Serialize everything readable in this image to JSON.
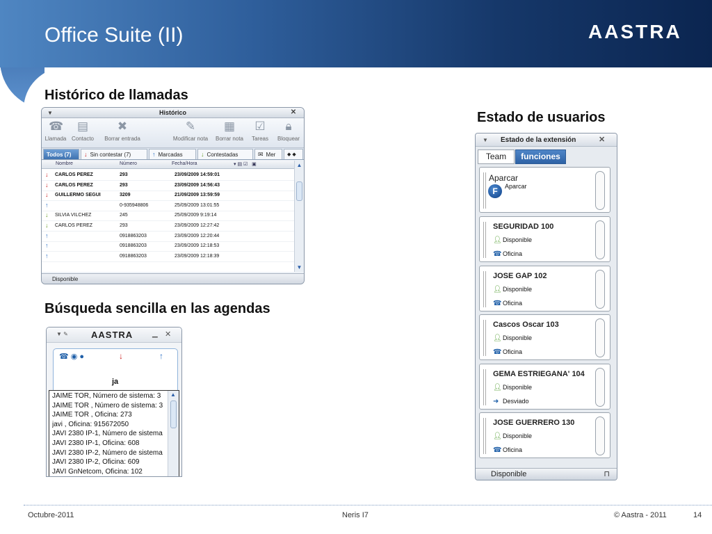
{
  "slide": {
    "title": "Office Suite (II)",
    "logo": "AASTRA",
    "footer": {
      "date": "Octubre-2011",
      "center": "Neris I7",
      "copyright": "© Aastra - 2011",
      "page": "14"
    }
  },
  "sections": {
    "history_heading": "Histórico de llamadas",
    "status_heading": "Estado de usuarios",
    "search_heading": "Búsqueda sencilla en las agendas"
  },
  "history_window": {
    "title": "Histórico",
    "toolbar": [
      {
        "label": "Llamada",
        "icon": "call-icon"
      },
      {
        "label": "Contacto",
        "icon": "contact-card-icon"
      },
      {
        "label": "Borrar entrada",
        "icon": "delete-x-icon"
      },
      {
        "label": "Modificar nota",
        "icon": "edit-note-icon"
      },
      {
        "label": "Borrar nota",
        "icon": "delete-note-icon"
      },
      {
        "label": "Tareas",
        "icon": "tasks-icon"
      },
      {
        "label": "Bloquear",
        "icon": "lock-icon"
      }
    ],
    "tabs": [
      "Todos (7)",
      "Sin contestar (7)",
      "Marcadas",
      "Contestadas",
      "Mer"
    ],
    "columns": [
      "Nombre",
      "Número",
      "Fecha/Hora"
    ],
    "rows": [
      {
        "dir": "missed",
        "name": "CARLOS PEREZ",
        "number": "293",
        "datetime": "23/09/2009 14:59:01",
        "bold": true
      },
      {
        "dir": "missed",
        "name": "CARLOS PEREZ",
        "number": "293",
        "datetime": "23/09/2009 14:56:43",
        "bold": true
      },
      {
        "dir": "missed",
        "name": "GUILLERMO SEGUI",
        "number": "3209",
        "datetime": "21/09/2009 13:59:59",
        "bold": true
      },
      {
        "dir": "outgoing",
        "name": "",
        "number": "0-935948806",
        "datetime": "25/09/2009 13:01:55",
        "bold": false
      },
      {
        "dir": "incoming",
        "name": "SILVIA VILCHEZ",
        "number": "245",
        "datetime": "25/09/2009 9:19:14",
        "bold": false
      },
      {
        "dir": "incoming",
        "name": "CARLOS PEREZ",
        "number": "293",
        "datetime": "23/09/2009 12:27:42",
        "bold": false
      },
      {
        "dir": "outgoing",
        "name": "",
        "number": "0918863203",
        "datetime": "23/09/2009 12:20:44",
        "bold": false
      },
      {
        "dir": "outgoing",
        "name": "",
        "number": "0918863203",
        "datetime": "23/09/2009 12:18:53",
        "bold": false
      },
      {
        "dir": "outgoing",
        "name": "",
        "number": "0918863203",
        "datetime": "23/09/2009 12:18:39",
        "bold": false
      }
    ],
    "status": "Disponible"
  },
  "search_window": {
    "logo": "AASTRA",
    "query": "ja",
    "results": [
      "JAIME TOR,  Número de sistema: 3",
      "JAIME TOR ,  Número de sistema: 3",
      "JAIME TOR ,  Oficina: 273",
      "javi ,  Oficina: 915672050",
      "JAVI 2380 IP-1,  Número de sistema",
      "JAVI 2380 IP-1,  Oficina: 608",
      "JAVI 2380 IP-2,  Número de sistema",
      "JAVI 2380 IP-2,  Oficina: 609",
      "JAVI GnNetcom,  Oficina: 102"
    ]
  },
  "status_window": {
    "title": "Estado de la extensión",
    "tabs": [
      "Team",
      "funciones"
    ],
    "park": {
      "title": "Aparcar",
      "label": "Aparcar",
      "badge": "F"
    },
    "users": [
      {
        "name": "SEGURIDAD 100",
        "status": "Disponible",
        "location": "Oficina",
        "loc_icon": "phone-icon"
      },
      {
        "name": "JOSE GAP 102",
        "status": "Disponible",
        "location": "Oficina",
        "loc_icon": "phone-icon"
      },
      {
        "name": "Cascos Oscar 103",
        "status": "Disponible",
        "location": "Oficina",
        "loc_icon": "phone-icon"
      },
      {
        "name": "GEMA ESTRIEGANA' 104",
        "status": "Disponible",
        "location": "Desviado",
        "loc_icon": "forward-arrow-icon"
      },
      {
        "name": "JOSE GUERRERO 130",
        "status": "Disponible",
        "location": "Oficina",
        "loc_icon": "phone-icon"
      }
    ],
    "status": "Disponible"
  }
}
